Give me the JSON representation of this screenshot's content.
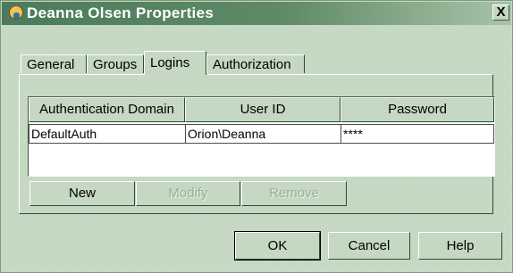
{
  "window": {
    "title": "Deanna Olsen Properties",
    "close_label": "X",
    "colors": {
      "face": "#c4d8c2",
      "title_bar": "#4b7b5a"
    }
  },
  "tabs": [
    {
      "label": "General",
      "active": false
    },
    {
      "label": "Groups",
      "active": false
    },
    {
      "label": "Logins",
      "active": true
    },
    {
      "label": "Authorization",
      "active": false
    }
  ],
  "logins_table": {
    "columns": [
      "Authentication Domain",
      "User ID",
      "Password"
    ],
    "rows": [
      [
        "DefaultAuth",
        "Orion\\Deanna",
        "****"
      ]
    ]
  },
  "table_buttons": {
    "new": "New",
    "modify": "Modify",
    "remove": "Remove"
  },
  "dialog_buttons": {
    "ok": "OK",
    "cancel": "Cancel",
    "help": "Help"
  }
}
